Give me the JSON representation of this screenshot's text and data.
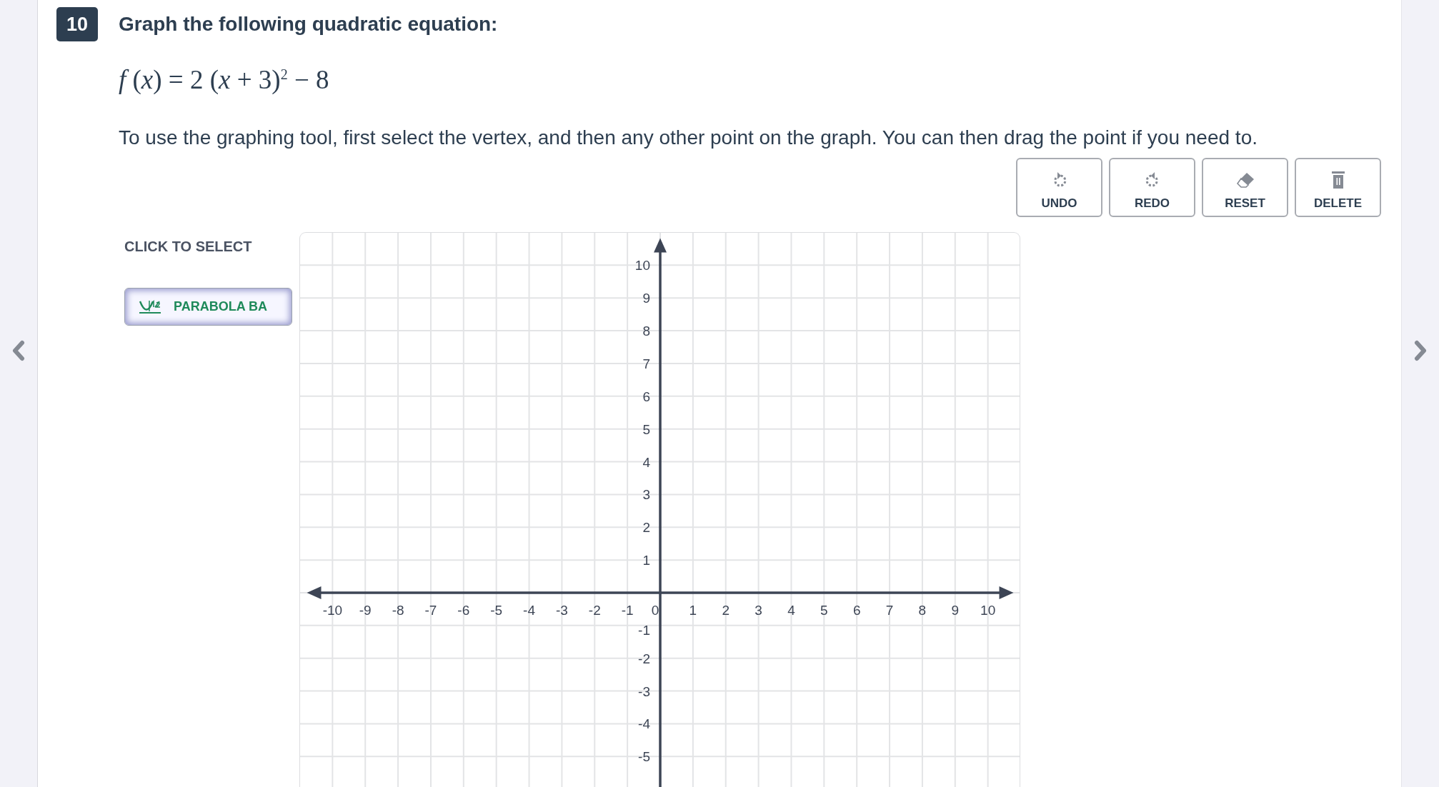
{
  "question": {
    "number": "10",
    "title": "Graph the following quadratic equation:",
    "formula": "*f* (*x*) = 2 (*x* + 3)$^{2}$ − 8",
    "instruction": "To use the graphing tool, first select the vertex, and then any other point on the graph.  You can then drag the point if you need to."
  },
  "toolbar": [
    {
      "kind": "undo",
      "label": "UNDO"
    },
    {
      "kind": "redo",
      "label": "REDO"
    },
    {
      "kind": "reset",
      "label": "RESET"
    },
    {
      "kind": "delete",
      "label": "DELETE"
    }
  ],
  "tools": {
    "heading": "CLICK TO SELECT",
    "items": [
      {
        "label": "PARABOLA BA",
        "selected": true
      }
    ]
  },
  "graph": {
    "chart_data": {
      "type": "scatter",
      "xlim": [
        -11,
        11
      ],
      "ylim": [
        -6,
        11
      ],
      "xticks": [
        -10,
        -9,
        -8,
        -7,
        -6,
        -5,
        -4,
        -3,
        -2,
        -1,
        0,
        1,
        2,
        3,
        4,
        5,
        6,
        7,
        8,
        9,
        10
      ],
      "grid": true,
      "yticks": [
        10,
        9,
        8,
        7,
        6,
        5,
        4,
        3,
        2,
        1,
        -1,
        -2,
        -3,
        -4,
        -5
      ]
    }
  }
}
